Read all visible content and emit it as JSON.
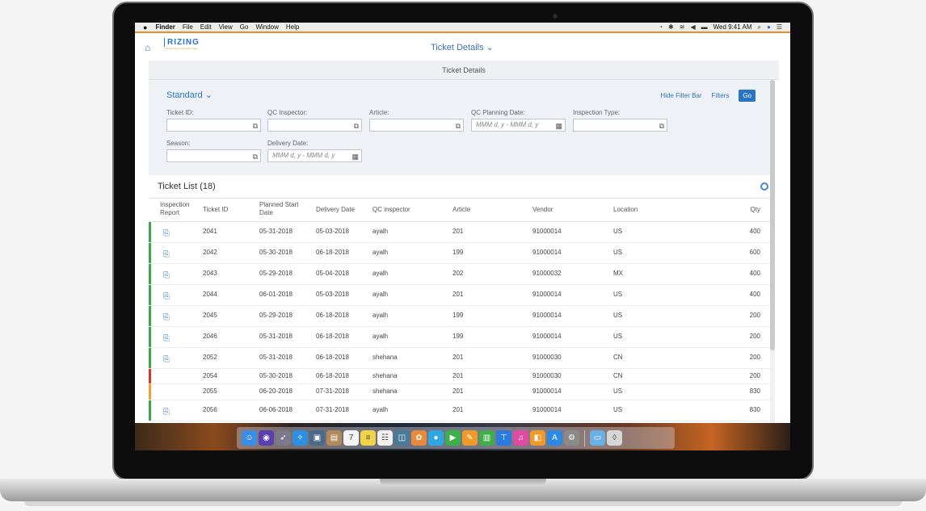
{
  "menubar": {
    "apple": "",
    "items": [
      "Finder",
      "File",
      "Edit",
      "View",
      "Go",
      "Window",
      "Help"
    ],
    "clock": "Wed 9:41 AM"
  },
  "app": {
    "logo_text": "RIZING",
    "logo_tagline": "Transforming the world of trade",
    "page_title": "Ticket Details",
    "sub_title": "Ticket Details"
  },
  "filter": {
    "variant": "Standard",
    "hide_filter_bar": "Hide Filter Bar",
    "filters": "Filters",
    "go": "Go",
    "fields": [
      {
        "label": "Ticket ID:",
        "placeholder": ""
      },
      {
        "label": "QC Inspector:",
        "placeholder": ""
      },
      {
        "label": "Article:",
        "placeholder": ""
      },
      {
        "label": "QC Planning Date:",
        "placeholder": "MMM d, y - MMM d, y"
      },
      {
        "label": "Inspection Type:",
        "placeholder": ""
      },
      {
        "label": "Season:",
        "placeholder": ""
      },
      {
        "label": "Delivery Date:",
        "placeholder": "MMM d, y - MMM d, y"
      }
    ]
  },
  "table": {
    "title": "Ticket List (18)",
    "columns": [
      "Inspection Report",
      "Ticket ID",
      "Planned Start Date",
      "Delivery Date",
      "QC inspector",
      "Article",
      "Vendor",
      "Location",
      "Qty"
    ],
    "rows": [
      {
        "report": true,
        "status": "green",
        "id": "2041",
        "start": "05-31-2018",
        "delivery": "05-03-2018",
        "inspector": "ayalh",
        "article": "201",
        "vendor": "91000014",
        "location": "US",
        "qty": "400"
      },
      {
        "report": true,
        "status": "green",
        "id": "2042",
        "start": "05-30-2018",
        "delivery": "06-18-2018",
        "inspector": "ayalh",
        "article": "199",
        "vendor": "91000014",
        "location": "US",
        "qty": "600"
      },
      {
        "report": true,
        "status": "green",
        "id": "2043",
        "start": "05-29-2018",
        "delivery": "05-04-2018",
        "inspector": "ayalh",
        "article": "202",
        "vendor": "91000032",
        "location": "MX",
        "qty": "400"
      },
      {
        "report": true,
        "status": "green",
        "id": "2044",
        "start": "06-01-2018",
        "delivery": "05-03-2018",
        "inspector": "ayalh",
        "article": "201",
        "vendor": "91000014",
        "location": "US",
        "qty": "400"
      },
      {
        "report": true,
        "status": "green",
        "id": "2045",
        "start": "05-29-2018",
        "delivery": "06-18-2018",
        "inspector": "ayalh",
        "article": "199",
        "vendor": "91000014",
        "location": "US",
        "qty": "200"
      },
      {
        "report": true,
        "status": "green",
        "id": "2046",
        "start": "05-31-2018",
        "delivery": "06-18-2018",
        "inspector": "ayalh",
        "article": "199",
        "vendor": "91000014",
        "location": "US",
        "qty": "200"
      },
      {
        "report": true,
        "status": "green",
        "id": "2052",
        "start": "05-31-2018",
        "delivery": "06-18-2018",
        "inspector": "shehana",
        "article": "201",
        "vendor": "91000030",
        "location": "CN",
        "qty": "200"
      },
      {
        "report": false,
        "status": "red",
        "id": "2054",
        "start": "05-30-2018",
        "delivery": "06-18-2018",
        "inspector": "shehana",
        "article": "201",
        "vendor": "91000030",
        "location": "CN",
        "qty": "200"
      },
      {
        "report": false,
        "status": "orange",
        "id": "2055",
        "start": "06-20-2018",
        "delivery": "07-31-2018",
        "inspector": "shehana",
        "article": "201",
        "vendor": "91000014",
        "location": "US",
        "qty": "830"
      },
      {
        "report": true,
        "status": "green",
        "id": "2056",
        "start": "06-06-2018",
        "delivery": "07-31-2018",
        "inspector": "ayalh",
        "article": "201",
        "vendor": "91000014",
        "location": "US",
        "qty": "830"
      }
    ]
  },
  "colors": {
    "accent": "#2b73c4",
    "green": "#3fa34d",
    "red": "#d9342b",
    "orange": "#f0a030",
    "menubar_line": "#f08a24"
  },
  "dock": {
    "icons": [
      {
        "name": "finder-icon",
        "glyph": "☺",
        "color": "#3a8ee6"
      },
      {
        "name": "siri-icon",
        "glyph": "◉",
        "color": "#5b3fb0"
      },
      {
        "name": "launchpad-icon",
        "glyph": "➶",
        "color": "#7a7a8a"
      },
      {
        "name": "safari-icon",
        "glyph": "✧",
        "color": "#2e8fe0"
      },
      {
        "name": "photo-browser-icon",
        "glyph": "▣",
        "color": "#4a6a8a"
      },
      {
        "name": "contacts-icon",
        "glyph": "▤",
        "color": "#b08a5a"
      },
      {
        "name": "calendar-icon",
        "glyph": "7",
        "color": "#f4f4f4"
      },
      {
        "name": "notes-icon",
        "glyph": "≡",
        "color": "#f2d24a"
      },
      {
        "name": "reminders-icon",
        "glyph": "☷",
        "color": "#f0f0f0"
      },
      {
        "name": "photo-booth-icon",
        "glyph": "◫",
        "color": "#4a7a9a"
      },
      {
        "name": "photos-icon",
        "glyph": "✿",
        "color": "#e88a3a"
      },
      {
        "name": "messages-icon",
        "glyph": "●",
        "color": "#2ea7e0"
      },
      {
        "name": "facetime-icon",
        "glyph": "▶",
        "color": "#3cb04a"
      },
      {
        "name": "pages-icon",
        "glyph": "✎",
        "color": "#f09a2a"
      },
      {
        "name": "numbers-icon",
        "glyph": "▥",
        "color": "#3cae4a"
      },
      {
        "name": "keynote-icon",
        "glyph": "⊤",
        "color": "#2a7ae0"
      },
      {
        "name": "itunes-icon",
        "glyph": "♫",
        "color": "#e04aa0"
      },
      {
        "name": "ibooks-icon",
        "glyph": "◧",
        "color": "#f09a2a"
      },
      {
        "name": "app-store-icon",
        "glyph": "A",
        "color": "#2a8ae6"
      },
      {
        "name": "system-preferences-icon",
        "glyph": "⚙",
        "color": "#8a8a8a"
      },
      {
        "name": "downloads-folder-icon",
        "glyph": "▭",
        "color": "#6ab0e6"
      },
      {
        "name": "trash-icon",
        "glyph": "◊",
        "color": "#d6d6d6"
      }
    ]
  }
}
